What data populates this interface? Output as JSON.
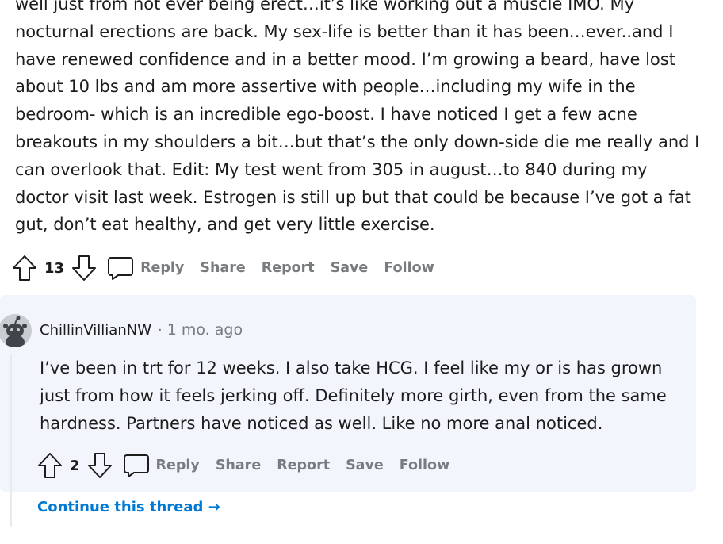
{
  "parent_comment": {
    "text": "well just from not ever being erect…it’s like working out a muscle IMO. My nocturnal erections are back. My sex-life is better than it has been…ever..and I have renewed confidence and in a better mood. I’m growing a beard, have lost about 10 lbs and am more assertive with people…including my wife in the bedroom- which is an incredible ego-boost. I have noticed I get a few acne breakouts in my shoulders a bit…but that’s the only down-side die me really and I can overlook that. Edit: My test went from 305 in august…to 840 during my doctor visit last week. Estrogen is still up but that could be because I’ve got a fat gut, don’t eat healthy, and get very little exercise.",
    "score": "13",
    "actions": {
      "reply": "Reply",
      "share": "Share",
      "report": "Report",
      "save": "Save",
      "follow": "Follow"
    }
  },
  "child_comment": {
    "username": "ChillinVillianNW",
    "separator": "·",
    "timestamp": "1 mo. ago",
    "text": "I’ve been in trt for 12 weeks. I also take HCG. I feel like my or is has grown just from how it feels jerking off. Definitely more girth, even from the same hardness. Partners have noticed as well. Like no more anal noticed.",
    "score": "2",
    "actions": {
      "reply": "Reply",
      "share": "Share",
      "report": "Report",
      "save": "Save",
      "follow": "Follow"
    }
  },
  "continue_thread": "Continue this thread →",
  "icons": {
    "upvote": "upvote-arrow-icon",
    "downvote": "downvote-arrow-icon",
    "comment": "comment-bubble-icon",
    "avatar": "snoo-avatar"
  },
  "colors": {
    "text": "#1c1c1c",
    "muted": "#787c7e",
    "link": "#0079d3",
    "card_bg": "#f2f5fc"
  }
}
